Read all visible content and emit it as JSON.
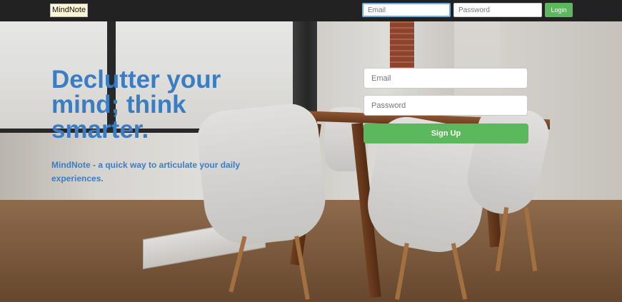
{
  "navbar": {
    "brand": "MindNote",
    "email_placeholder": "Email",
    "password_placeholder": "Password",
    "login_label": "Login"
  },
  "hero": {
    "headline": "Declutter your mind; think smarter.",
    "tagline": "MindNote - a quick way to articulate your daily experiences."
  },
  "signup": {
    "email_placeholder": "Email",
    "password_placeholder": "Password",
    "button_label": "Sign Up"
  },
  "colors": {
    "navbar_bg": "#222222",
    "accent_blue": "#3a7dc4",
    "button_green": "#5cb85c"
  }
}
